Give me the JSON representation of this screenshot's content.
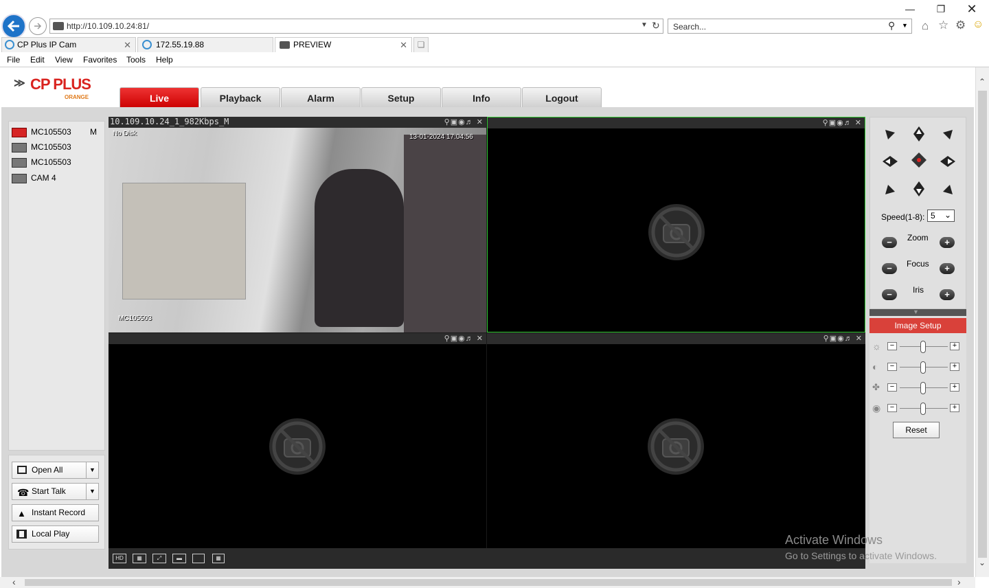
{
  "browser": {
    "url": "http://10.109.10.24:81/",
    "search_placeholder": "Search...",
    "tabs": [
      {
        "label": "CP Plus IP Cam"
      },
      {
        "label": "172.55.19.88"
      },
      {
        "label": "PREVIEW"
      }
    ],
    "menu": [
      "File",
      "Edit",
      "View",
      "Favorites",
      "Tools",
      "Help"
    ]
  },
  "app": {
    "logo": "CP PLUS",
    "logo_sub": "ORANGE",
    "nav_tabs": [
      "Live",
      "Playback",
      "Alarm",
      "Setup",
      "Info",
      "Logout"
    ],
    "active_tab": "Live",
    "brand_color": "#d9413a"
  },
  "camera_list": [
    {
      "name": "MC105503",
      "tag": "M",
      "active": true
    },
    {
      "name": "MC105503",
      "tag": "",
      "active": false
    },
    {
      "name": "MC105503",
      "tag": "",
      "active": false
    },
    {
      "name": "CAM 4",
      "tag": "",
      "active": false
    }
  ],
  "actions": {
    "open_all": "Open All",
    "start_talk": "Start Talk",
    "instant_record": "Instant Record",
    "local_play": "Local Play"
  },
  "video": {
    "pane1_title": "10.109.10.24_1_982Kbps_M",
    "pane1_status": "No Disk",
    "pane1_timestamp": "13-01-2024 17:04:56",
    "pane1_camera": "MC105503"
  },
  "ptz": {
    "speed_label": "Speed(1-8):",
    "speed_value": "5",
    "zoom": "Zoom",
    "focus": "Focus",
    "iris": "Iris"
  },
  "image_setup": {
    "title": "Image Setup",
    "reset": "Reset"
  },
  "watermark": {
    "line1": "Activate Windows",
    "line2": "Go to Settings to activate Windows."
  }
}
